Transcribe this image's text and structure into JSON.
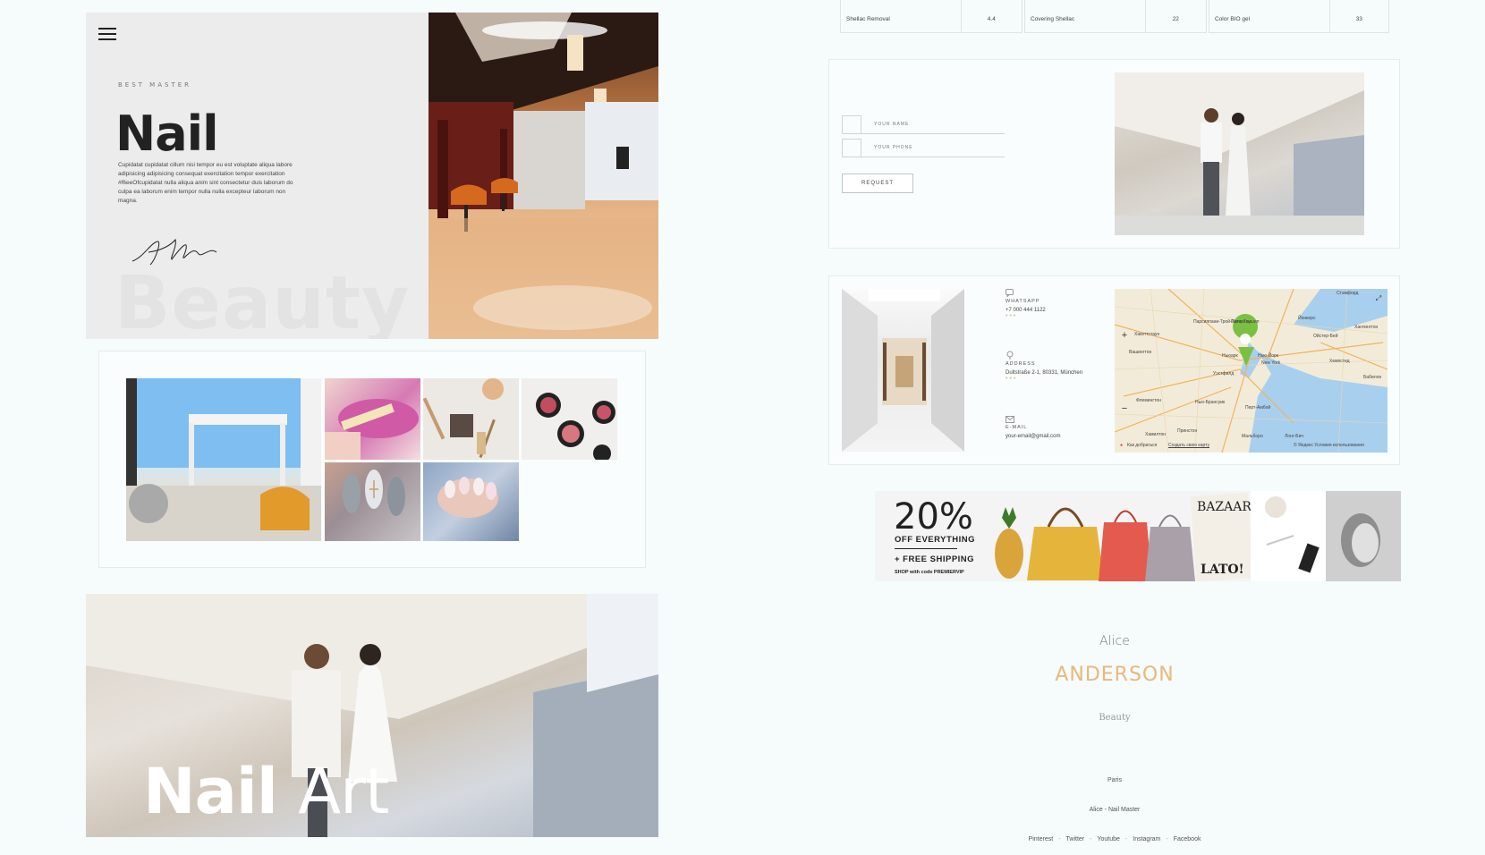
{
  "hero": {
    "eyebrow": "BEST MASTER",
    "title": "Nail",
    "text": "Cupidatat cupidatat cillum nisi tempor eu est voluptate aliqua labore adipisicing adipisicing consequat exercitation tempor exercitation #f6eeOfcupidatat nulla aliqua anim sint consectetur duis laborum do culpa ea laborum enim tempor nulla nulla excepteur laborum non magna.",
    "ghost_word": "Beauty"
  },
  "nail_art": {
    "title_bold": "Nail",
    "title_light": "Art"
  },
  "prices": [
    {
      "service": "Shellac Removal",
      "price": "4.4"
    },
    {
      "service": "Covering Shellac",
      "price": "22"
    },
    {
      "service": "Color BIO gel",
      "price": "33"
    }
  ],
  "form": {
    "name_placeholder": "YOUR NAME",
    "phone_placeholder": "YOUR PHONE",
    "submit_label": "REQUEST"
  },
  "contact": {
    "whatsapp_label": "WHATSAPP",
    "whatsapp_value": "+7 000 444 1122",
    "address_label": "ADDRESS",
    "address_value": "Dultstraße 2-1, 80331, München",
    "email_label": "E-MAIL",
    "email_value": "your-email@gmail.com",
    "dots": "•••"
  },
  "map": {
    "labels": {
      "stamford": "Стэмфорд",
      "paterson": "Патерсон",
      "yonkers": "Йонкерс",
      "newark": "Ньюарк",
      "new_york": "Нью-Йорк",
      "new_york_en": "New York",
      "hempstead": "Хемпстед",
      "babylon": "Бабилон",
      "oyster_bay": "Ойстер-Бей",
      "huntington": "Хантингтон",
      "westfield": "Уэстфилд",
      "new_brunswick": "Нью-Брансуик",
      "perth_amboy": "Перт-Амбой",
      "long_beach": "Лонг-Бич",
      "flemington": "Флемингтон",
      "princeton": "Принстон",
      "hamilton": "Хамилтон",
      "marlboro": "Мальборо",
      "hackettstown": "Хакеттстаун",
      "washington": "Вашингтон",
      "parsippany": "Парсиппани-Трой-Хилс-Таушип"
    },
    "route": "Как добраться",
    "create_map": "Создать свою карту",
    "attribution": "© Яндекс Условия использования"
  },
  "promo": {
    "percent": "20%",
    "off": "OFF EVERYTHING",
    "shipping": "+ FREE SHIPPING",
    "code": "SHOP with code PREMIERVIP",
    "magazine": "BAZAAR",
    "magazine_sub": "LATO!"
  },
  "footer": {
    "first_name": "Alice",
    "last_name": "ANDERSON",
    "tagline": "Beauty",
    "city": "Paris",
    "brand": "Alice - Nail Master",
    "social": [
      "Pinterest",
      "Twitter",
      "Youtube",
      "Instagram",
      "Facebook"
    ]
  },
  "colors": {
    "accent_gold": "#e8b87e",
    "map_pin": "#7ac142",
    "water": "#a9cfee"
  }
}
